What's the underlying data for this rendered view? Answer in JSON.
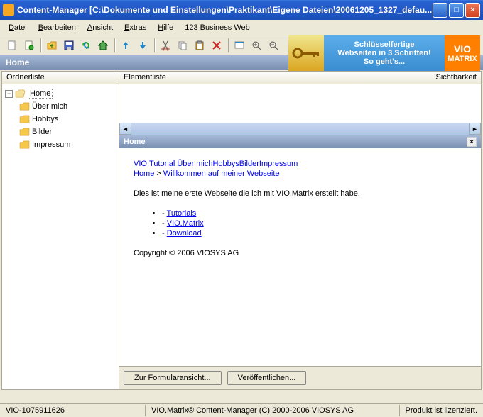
{
  "window": {
    "title": "Content-Manager [C:\\Dokumente und Einstellungen\\Praktikant\\Eigene Dateien\\20061205_1327_defau..."
  },
  "menu": {
    "items": [
      "Datei",
      "Bearbeiten",
      "Ansicht",
      "Extras",
      "Hilfe",
      "123 Business Web"
    ]
  },
  "banner": {
    "line1": "Schlüsselfertige",
    "line2": "Webseiten in 3 Schritten!",
    "line3": "So geht's...",
    "logo_top": "VIO",
    "logo_bottom": "MATRIX"
  },
  "section_title": "Home",
  "sidebar": {
    "header": "Ordnerliste",
    "root": "Home",
    "children": [
      "Über mich",
      "Hobbys",
      "Bilder",
      "Impressum"
    ]
  },
  "content": {
    "header_left": "Elementliste",
    "header_right": "Sichtbarkeit",
    "panel_title": "Home",
    "nav_links": [
      "VIO.Tutorial",
      "Über mich",
      "Hobbys",
      "Bilder",
      "Impressum"
    ],
    "breadcrumb_home": "Home",
    "breadcrumb_sep": " > ",
    "breadcrumb_page": "Willkommen auf meiner Webseite",
    "intro": "Dies ist meine erste Webseite die ich mit VIO.Matrix erstellt habe.",
    "list_prefix": "- ",
    "list_items": [
      "Tutorials",
      "VIO.Matrix",
      "Download"
    ],
    "copyright": "Copyright © 2006 VIOSYS AG"
  },
  "buttons": {
    "form_view": "Zur Formularansicht...",
    "publish": "Veröffentlichen..."
  },
  "status": {
    "left": "VIO-1075911626",
    "center": "VIO.Matrix® Content-Manager (C) 2000-2006 VIOSYS AG",
    "right": "Produkt ist lizenziert."
  }
}
